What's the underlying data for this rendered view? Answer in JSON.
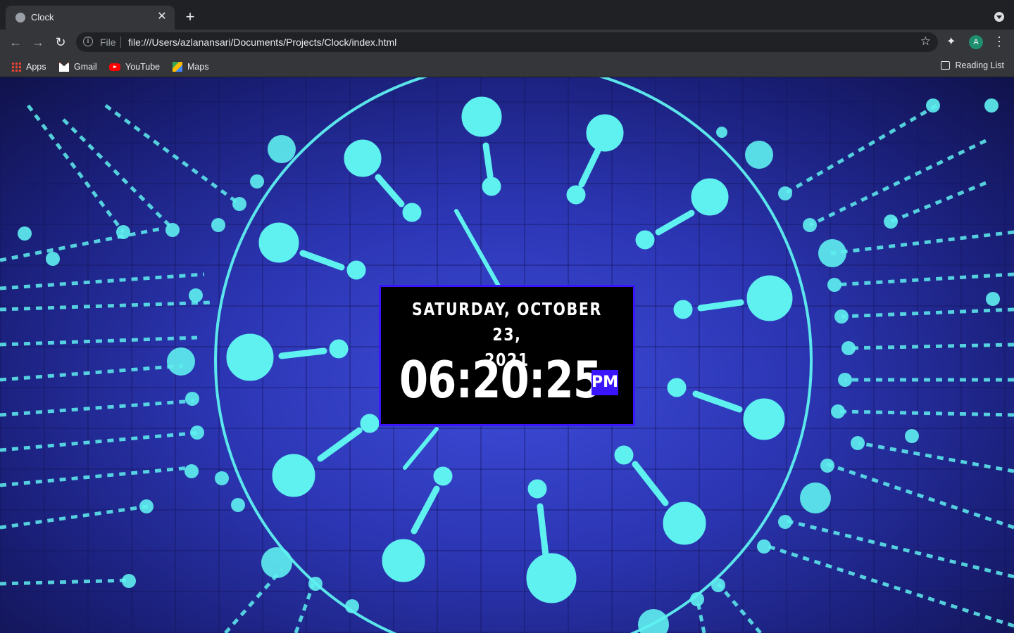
{
  "browser": {
    "tab": {
      "title": "Clock",
      "close_icon": "close-icon"
    },
    "new_tab_label": "+",
    "address": {
      "scheme_label": "File",
      "url": "file:///Users/azlanansari/Documents/Projects/Clock/index.html"
    },
    "profile_initial": "A",
    "bookmarks": [
      {
        "label": "Apps",
        "icon": "apps-icon"
      },
      {
        "label": "Gmail",
        "icon": "gmail-icon"
      },
      {
        "label": "YouTube",
        "icon": "youtube-icon"
      },
      {
        "label": "Maps",
        "icon": "maps-icon"
      }
    ],
    "reading_list_label": "Reading List"
  },
  "clock": {
    "date": "SATURDAY, OCTOBER 23, 2021",
    "date_line1": "SATURDAY, OCTOBER 23,",
    "date_line2": "2021",
    "time": "06:20:25",
    "period": "PM",
    "accent_color": "#3a16ff",
    "background_color": "#000000"
  },
  "theme": {
    "glow_color": "#5ff0f0",
    "circuit_blue": "#2c36b4"
  }
}
